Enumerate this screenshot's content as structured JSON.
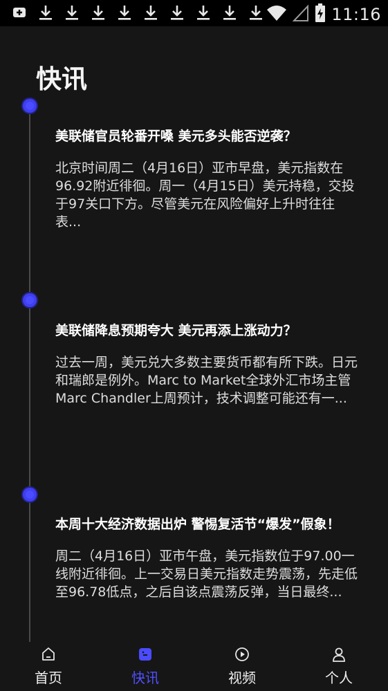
{
  "status_bar": {
    "time": "11:16",
    "left_icons": [
      "usb-debug-icon",
      "download-icon",
      "download-icon",
      "download-icon",
      "download-icon",
      "download-icon",
      "download-icon",
      "download-icon",
      "download-icon",
      "download-icon"
    ],
    "right_icons": [
      "wifi-icon",
      "cell-signal-icon",
      "battery-charging-icon"
    ]
  },
  "page": {
    "title": "快讯"
  },
  "news": [
    {
      "title": "美联储官员轮番开嗓 美元多头能否逆袭？",
      "summary": "北京时间周二（4月16日）亚市早盘，美元指数在96.92附近徘徊。周一（4月15日）美元持稳，交投于97关口下方。尽管美元在风险偏好上升时往往表..."
    },
    {
      "title": "美联储降息预期夸大 美元再添上涨动力？",
      "summary": "过去一周，美元兑大多数主要货币都有所下跌。日元和瑞郎是例外。Marc to Market全球外汇市场主管Marc Chandler上周预计，技术调整可能还有一..."
    },
    {
      "title": "本周十大经济数据出炉 警惕复活节“爆发”假象！",
      "summary": "周二（4月16日）亚市午盘，美元指数位于97.00一线附近徘徊。上一交易日美元指数走势震荡，先走低至96.78低点，之后自该点震荡反弹，当日最终..."
    }
  ],
  "bottom_nav": {
    "active": "快讯",
    "items": [
      {
        "label": "首页",
        "icon": "home-icon"
      },
      {
        "label": "快讯",
        "icon": "news-icon"
      },
      {
        "label": "视频",
        "icon": "play-icon"
      },
      {
        "label": "个人",
        "icon": "person-icon"
      }
    ]
  },
  "colors": {
    "accent": "#4b4bff",
    "background": "#161616",
    "status_bar": "#000000"
  }
}
